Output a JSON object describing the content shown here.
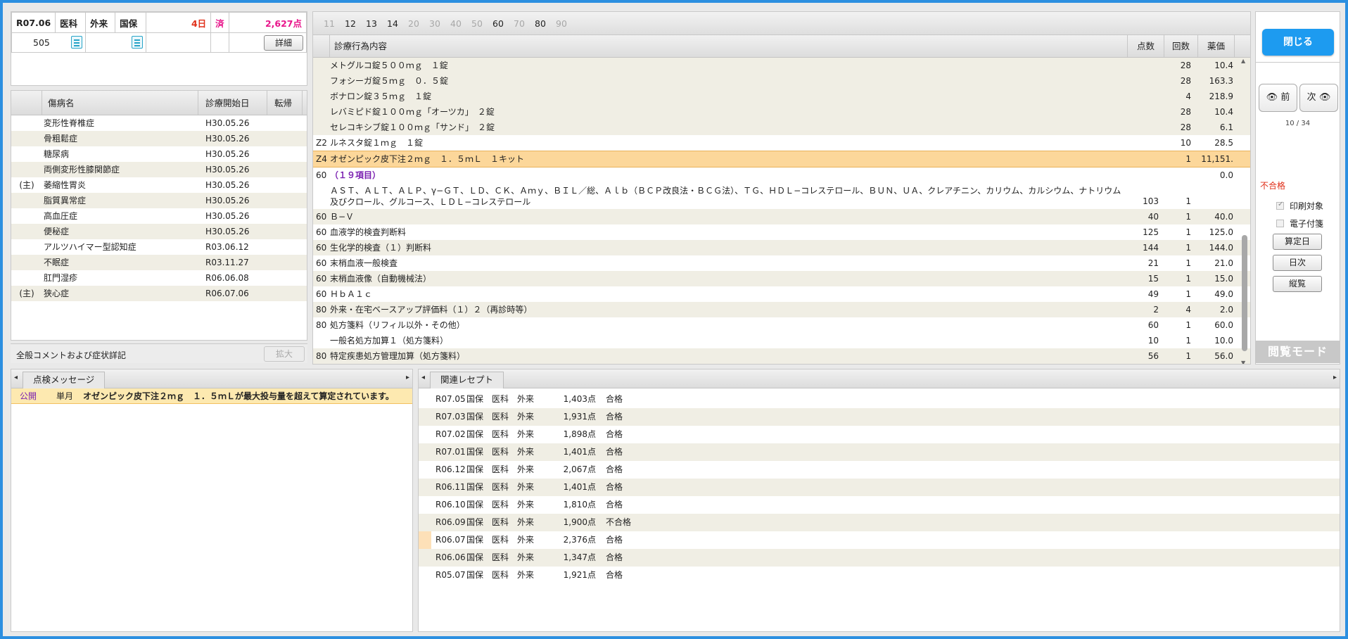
{
  "header": {
    "date": "R07.06",
    "dept": "医科",
    "visit": "外来",
    "insurance": "国保",
    "days": "4日",
    "status": "済",
    "points": "2,627点",
    "patient_no": "505",
    "detail_label": "詳細"
  },
  "diseases": {
    "columns": [
      "傷病名",
      "診療開始日",
      "転帰"
    ],
    "rows": [
      {
        "main": "",
        "name": "変形性脊椎症",
        "start": "H30.05.26",
        "outcome": ""
      },
      {
        "main": "",
        "name": "骨粗鬆症",
        "start": "H30.05.26",
        "outcome": ""
      },
      {
        "main": "",
        "name": "糖尿病",
        "start": "H30.05.26",
        "outcome": ""
      },
      {
        "main": "",
        "name": "両側変形性膝関節症",
        "start": "H30.05.26",
        "outcome": ""
      },
      {
        "main": "(主)",
        "name": "萎縮性胃炎",
        "start": "H30.05.26",
        "outcome": ""
      },
      {
        "main": "",
        "name": "脂質異常症",
        "start": "H30.05.26",
        "outcome": ""
      },
      {
        "main": "",
        "name": "高血圧症",
        "start": "H30.05.26",
        "outcome": ""
      },
      {
        "main": "",
        "name": "便秘症",
        "start": "H30.05.26",
        "outcome": ""
      },
      {
        "main": "",
        "name": "アルツハイマー型認知症",
        "start": "R03.06.12",
        "outcome": ""
      },
      {
        "main": "",
        "name": "不眠症",
        "start": "R03.11.27",
        "outcome": ""
      },
      {
        "main": "",
        "name": "肛門湿疹",
        "start": "R06.06.08",
        "outcome": ""
      },
      {
        "main": "(主)",
        "name": "狭心症",
        "start": "R06.07.06",
        "outcome": ""
      }
    ]
  },
  "comment": {
    "label": "全般コメントおよび症状詳記",
    "expand_label": "拡大"
  },
  "treatment": {
    "tabs": [
      "11",
      "12",
      "13",
      "14",
      "20",
      "30",
      "40",
      "50",
      "60",
      "70",
      "80",
      "90"
    ],
    "active_tabs": [
      "12",
      "13",
      "14",
      "60",
      "80"
    ],
    "columns": [
      "診療行為内容",
      "点数",
      "回数",
      "薬価"
    ],
    "rows": [
      {
        "code": "",
        "text": "メトグルコ錠５００ｍｇ　１錠",
        "points": "",
        "count": "28",
        "price": "10.4",
        "bg": "beige"
      },
      {
        "code": "",
        "text": "フォシーガ錠５ｍｇ　０．５錠",
        "points": "",
        "count": "28",
        "price": "163.3",
        "bg": "beige"
      },
      {
        "code": "",
        "text": "ボナロン錠３５ｍｇ　１錠",
        "points": "",
        "count": "4",
        "price": "218.9",
        "bg": "beige"
      },
      {
        "code": "",
        "text": "レバミピド錠１００ｍｇ「オーツカ」　２錠",
        "points": "",
        "count": "28",
        "price": "10.4",
        "bg": "beige"
      },
      {
        "code": "",
        "text": "セレコキシブ錠１００ｍｇ「サンド」　２錠",
        "points": "",
        "count": "28",
        "price": "6.1",
        "bg": "beige"
      },
      {
        "code": "Z2",
        "text": "ルネスタ錠１ｍｇ　１錠",
        "points": "",
        "count": "10",
        "price": "28.5",
        "bg": "white"
      },
      {
        "code": "Z4",
        "text": "オゼンピック皮下注２ｍｇ　１．５ｍＬ　１キット",
        "points": "",
        "count": "1",
        "price": "11,151.",
        "bg": "highlight"
      },
      {
        "code": "60",
        "text": "（１９項目）",
        "points": "",
        "count": "",
        "price": "0.0",
        "bg": "white",
        "purple": true
      },
      {
        "code": "",
        "text": "ＡＳＴ、ＡＬＴ、ＡＬＰ、γ−ＧＴ、ＬＤ、ＣＫ、Ａｍｙ、ＢＩＬ／総、Ａｌｂ（ＢＣＰ改良法・ＢＣＧ法）、ＴＧ、ＨＤＬ−コレステロール、ＢＵＮ、ＵＡ、クレアチニン、カリウム、カルシウム、ナトリウム",
        "text2": "及びクロール、グルコース、ＬＤＬ−コレステロール",
        "points": "103",
        "count": "1",
        "price": "",
        "bg": "white"
      },
      {
        "code": "60",
        "text": "Ｂ−Ｖ",
        "points": "40",
        "count": "1",
        "price": "40.0",
        "bg": "beige"
      },
      {
        "code": "60",
        "text": "血液学的検査判断料",
        "points": "125",
        "count": "1",
        "price": "125.0",
        "bg": "white"
      },
      {
        "code": "60",
        "text": "生化学的検査（１）判断料",
        "points": "144",
        "count": "1",
        "price": "144.0",
        "bg": "beige"
      },
      {
        "code": "60",
        "text": "末梢血液一般検査",
        "points": "21",
        "count": "1",
        "price": "21.0",
        "bg": "white"
      },
      {
        "code": "60",
        "text": "末梢血液像（自動機械法）",
        "points": "15",
        "count": "1",
        "price": "15.0",
        "bg": "beige"
      },
      {
        "code": "60",
        "text": "ＨｂＡ１ｃ",
        "points": "49",
        "count": "1",
        "price": "49.0",
        "bg": "white"
      },
      {
        "code": "80",
        "text": "外来・在宅ベースアップ評価料（１）２（再診時等）",
        "points": "2",
        "count": "4",
        "price": "2.0",
        "bg": "beige"
      },
      {
        "code": "80",
        "text": "処方箋料（リフィル以外・その他）",
        "points": "60",
        "count": "1",
        "price": "60.0",
        "bg": "white"
      },
      {
        "code": "",
        "text": "一般名処方加算１（処方箋料）",
        "points": "10",
        "count": "1",
        "price": "10.0",
        "bg": "white"
      },
      {
        "code": "80",
        "text": "特定疾患処方管理加算（処方箋料）",
        "points": "56",
        "count": "1",
        "price": "56.0",
        "bg": "beige"
      }
    ]
  },
  "right_panel": {
    "close_label": "閉じる",
    "prev_label": "前",
    "next_label": "次",
    "page_counter": "10 / 34",
    "result": "不合格",
    "print_label": "印刷対象",
    "e_tag_label": "電子付箋",
    "calc_day_label": "算定日",
    "day_next_label": "日次",
    "vertical_label": "縦覧",
    "mode_label": "閲覧モード"
  },
  "check_messages": {
    "tab_label": "点検メッセージ",
    "rows": [
      {
        "scope": "公開",
        "period": "単月",
        "text": "オゼンピック皮下注２ｍｇ　１．５ｍＬが最大投与量を超えて算定されています。"
      }
    ]
  },
  "related": {
    "tab_label": "関連レセプト",
    "rows": [
      {
        "date": "R07.05",
        "ins": "国保",
        "dept": "医科",
        "visit": "外来",
        "points": "1,403点",
        "result": "合格",
        "mark": false
      },
      {
        "date": "R07.03",
        "ins": "国保",
        "dept": "医科",
        "visit": "外来",
        "points": "1,931点",
        "result": "合格",
        "mark": false
      },
      {
        "date": "R07.02",
        "ins": "国保",
        "dept": "医科",
        "visit": "外来",
        "points": "1,898点",
        "result": "合格",
        "mark": false
      },
      {
        "date": "R07.01",
        "ins": "国保",
        "dept": "医科",
        "visit": "外来",
        "points": "1,401点",
        "result": "合格",
        "mark": false
      },
      {
        "date": "R06.12",
        "ins": "国保",
        "dept": "医科",
        "visit": "外来",
        "points": "2,067点",
        "result": "合格",
        "mark": false
      },
      {
        "date": "R06.11",
        "ins": "国保",
        "dept": "医科",
        "visit": "外来",
        "points": "1,401点",
        "result": "合格",
        "mark": false
      },
      {
        "date": "R06.10",
        "ins": "国保",
        "dept": "医科",
        "visit": "外来",
        "points": "1,810点",
        "result": "合格",
        "mark": false
      },
      {
        "date": "R06.09",
        "ins": "国保",
        "dept": "医科",
        "visit": "外来",
        "points": "1,900点",
        "result": "不合格",
        "mark": false
      },
      {
        "date": "R06.07",
        "ins": "国保",
        "dept": "医科",
        "visit": "外来",
        "points": "2,376点",
        "result": "合格",
        "mark": true
      },
      {
        "date": "R06.06",
        "ins": "国保",
        "dept": "医科",
        "visit": "外来",
        "points": "1,347点",
        "result": "合格",
        "mark": false
      },
      {
        "date": "R05.07",
        "ins": "国保",
        "dept": "医科",
        "visit": "外来",
        "points": "1,921点",
        "result": "合格",
        "mark": false
      }
    ]
  },
  "colors": {
    "accent": "#1d9bf0",
    "frame": "#2c8fe0",
    "beige_row": "#f0eee4",
    "highlight_row": "#fcd79a",
    "alert": "#e0301a",
    "purple": "#7a1fb0",
    "message_bg": "#fde9b0"
  }
}
